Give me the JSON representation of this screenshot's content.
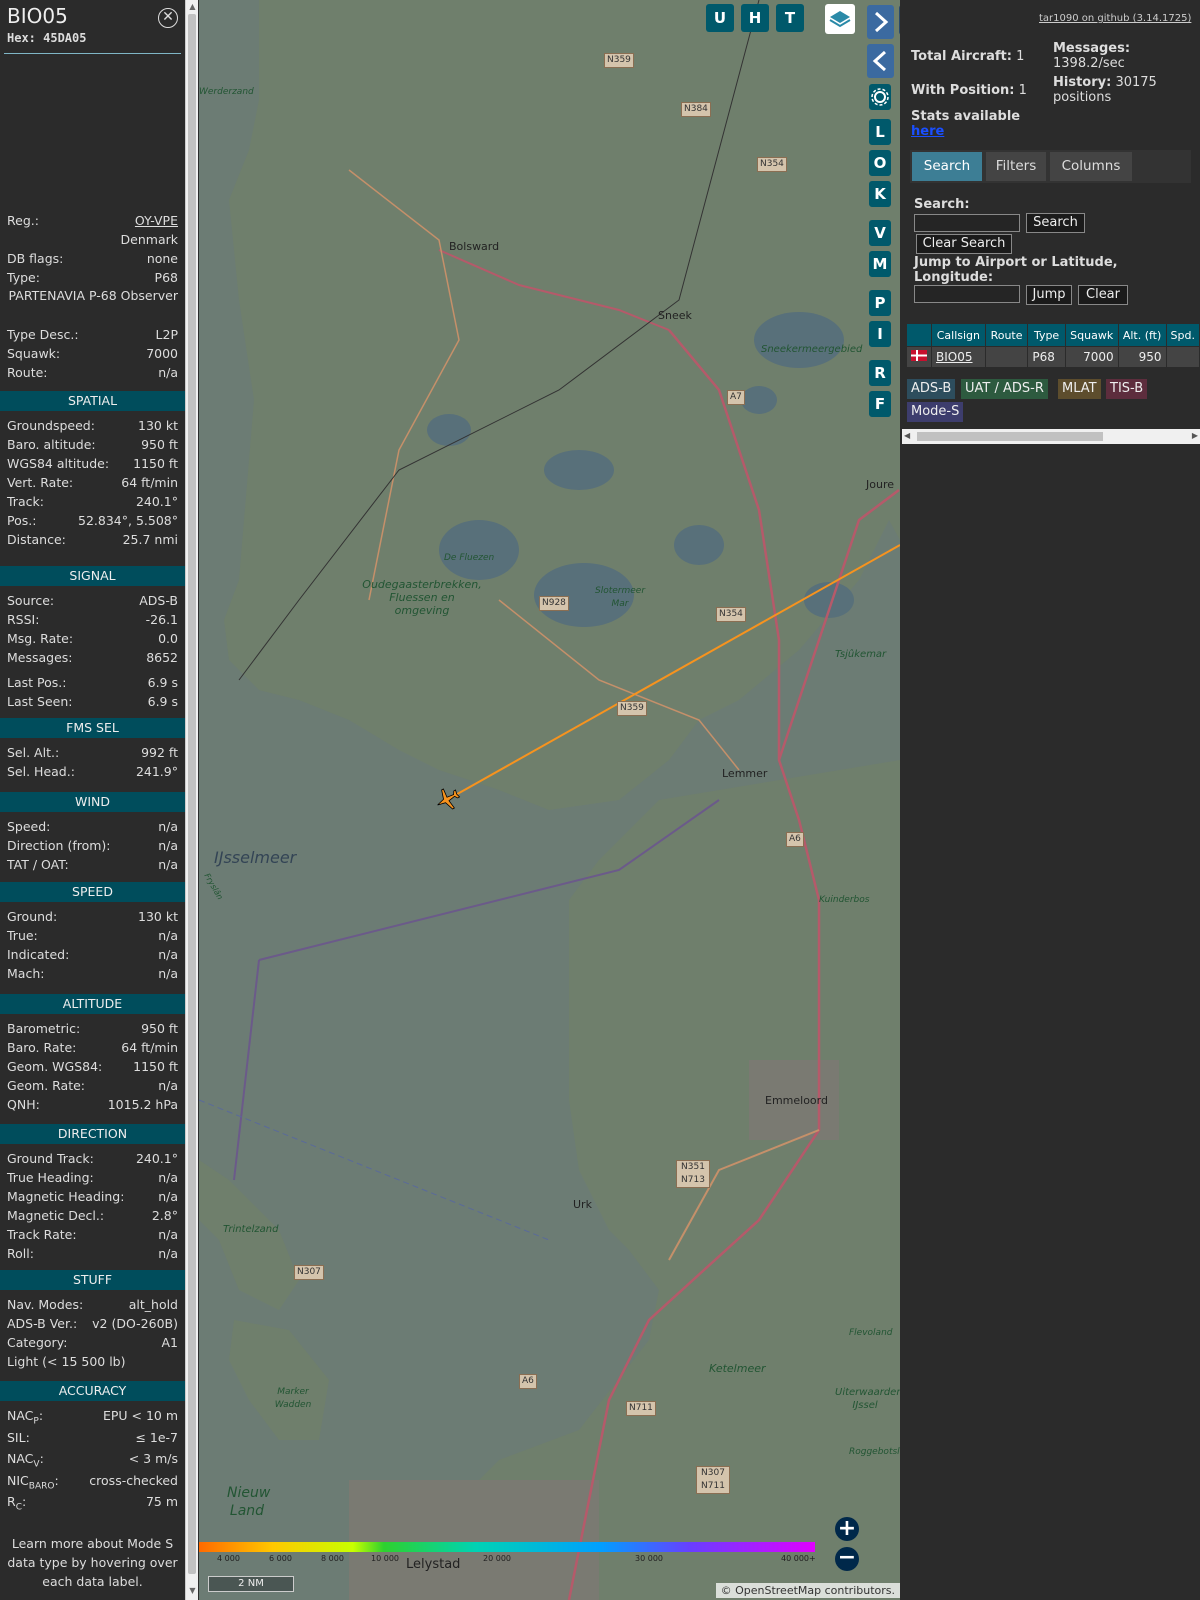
{
  "aircraft": {
    "callsign": "BIO05",
    "hex": "Hex: 45DA05",
    "rows_top": [
      {
        "k": "Reg.:",
        "v": "OY-VPE"
      },
      {
        "k": "",
        "v": "Denmark"
      },
      {
        "k": "DB flags:",
        "v": "none"
      },
      {
        "k": "Type:",
        "v": "P68"
      },
      {
        "k": "",
        "v": "PARTENAVIA P-68 Observer"
      },
      {
        "k": "Type Desc.:",
        "v": "L2P"
      },
      {
        "k": "Squawk:",
        "v": "7000"
      },
      {
        "k": "Route:",
        "v": "n/a"
      }
    ],
    "sections": [
      {
        "title": "SPATIAL",
        "rows": [
          {
            "k": "Groundspeed:",
            "v": "130 kt"
          },
          {
            "k": "Baro. altitude:",
            "v": "950 ft"
          },
          {
            "k": "WGS84 altitude:",
            "v": "1150 ft"
          },
          {
            "k": "Vert. Rate:",
            "v": "64 ft/min"
          },
          {
            "k": "Track:",
            "v": "240.1°"
          },
          {
            "k": "Pos.:",
            "v": "52.834°, 5.508°"
          },
          {
            "k": "Distance:",
            "v": "25.7 nmi"
          }
        ]
      },
      {
        "title": "SIGNAL",
        "rows": [
          {
            "k": "Source:",
            "v": "ADS-B"
          },
          {
            "k": "RSSI:",
            "v": "-26.1"
          },
          {
            "k": "Msg. Rate:",
            "v": "0.0"
          },
          {
            "k": "Messages:",
            "v": "8652"
          },
          {
            "k": "Last Pos.:",
            "v": "6.9 s"
          },
          {
            "k": "Last Seen:",
            "v": "6.9 s"
          }
        ]
      },
      {
        "title": "FMS SEL",
        "rows": [
          {
            "k": "Sel. Alt.:",
            "v": "992 ft"
          },
          {
            "k": "Sel. Head.:",
            "v": "241.9°"
          }
        ]
      },
      {
        "title": "WIND",
        "rows": [
          {
            "k": "Speed:",
            "v": "n/a"
          },
          {
            "k": "Direction (from):",
            "v": "n/a"
          },
          {
            "k": "TAT / OAT:",
            "v": "n/a"
          }
        ]
      },
      {
        "title": "SPEED",
        "rows": [
          {
            "k": "Ground:",
            "v": "130 kt"
          },
          {
            "k": "True:",
            "v": "n/a"
          },
          {
            "k": "Indicated:",
            "v": "n/a"
          },
          {
            "k": "Mach:",
            "v": "n/a"
          }
        ]
      },
      {
        "title": "ALTITUDE",
        "rows": [
          {
            "k": "Barometric:",
            "v": "950 ft"
          },
          {
            "k": "Baro. Rate:",
            "v": "64 ft/min"
          },
          {
            "k": "Geom. WGS84:",
            "v": "1150 ft"
          },
          {
            "k": "Geom. Rate:",
            "v": "n/a"
          },
          {
            "k": "QNH:",
            "v": "1015.2 hPa"
          }
        ]
      },
      {
        "title": "DIRECTION",
        "rows": [
          {
            "k": "Ground Track:",
            "v": "240.1°"
          },
          {
            "k": "True Heading:",
            "v": "n/a"
          },
          {
            "k": "Magnetic Heading:",
            "v": "n/a"
          },
          {
            "k": "Magnetic Decl.:",
            "v": "2.8°"
          },
          {
            "k": "Track Rate:",
            "v": "n/a"
          },
          {
            "k": "Roll:",
            "v": "n/a"
          }
        ]
      },
      {
        "title": "STUFF",
        "rows": [
          {
            "k": "Nav. Modes:",
            "v": "alt_hold"
          },
          {
            "k": "ADS-B Ver.:",
            "v": "v2 (DO-260B)"
          },
          {
            "k": "Category:",
            "v": "A1"
          },
          {
            "k": "Light (< 15 500 lb)",
            "v": ""
          }
        ]
      },
      {
        "title": "ACCURACY",
        "rows": [
          {
            "k": "NACP:",
            "v": "EPU < 10 m"
          },
          {
            "k": "SIL:",
            "v": "≤ 1e-7"
          },
          {
            "k": "NACV:",
            "v": "< 3 m/s"
          },
          {
            "k": "NICBARO:",
            "v": "cross-checked"
          },
          {
            "k": "RC:",
            "v": "75 m"
          }
        ]
      }
    ],
    "footer": "Learn more about Mode S data type by hovering over each data label."
  },
  "map": {
    "buttons_top": [
      "U",
      "H",
      "T"
    ],
    "buttons_side": [
      "L",
      "O",
      "K",
      "V",
      "M",
      "P",
      "I",
      "R",
      "F"
    ],
    "towns": [
      "Bolsward",
      "Sneek",
      "Joure",
      "Lemmer",
      "Emmeloord",
      "Urk",
      "Lelystad"
    ],
    "water": [
      "IJsselmeer",
      "Ketelmeer",
      "Sneekermeergebied",
      "Tsjûkemar"
    ],
    "parks": [
      "Oudegaasterbrekken, Fluessen en omgeving",
      "De Fluezen",
      "Slotermeer Mar",
      "Trintelzand",
      "Marker Wadden",
      "Nieuw Land",
      "Kuinderbos",
      "Uiterwaarden IJssel",
      "Roggebotsluis",
      "Werderzand",
      "Fryslân",
      "Flevoland"
    ],
    "roads": [
      "N359",
      "N384",
      "N354",
      "A7",
      "N928",
      "N354",
      "N359",
      "A6",
      "N351 N713",
      "N307",
      "A6",
      "N711",
      "N307 N711"
    ],
    "scale_ticks": [
      "4 000",
      "6 000",
      "8 000",
      "10 000",
      "20 000",
      "30 000",
      "40 000+"
    ],
    "scale_label": "2 NM",
    "attribution": "© OpenStreetMap contributors."
  },
  "right": {
    "github": "tar1090 on github (3.14.1725)",
    "total_label": "Total Aircraft:",
    "total": "1",
    "withpos_label": "With Position:",
    "withpos": "1",
    "messages_label": "Messages:",
    "messages": "1398.2/sec",
    "history_label": "History:",
    "history": "30175 positions",
    "stats_text": "Stats available",
    "stats_link": "here",
    "tabs": [
      "Search",
      "Filters",
      "Columns"
    ],
    "search_label": "Search:",
    "search_btn": "Search",
    "clear_search_btn": "Clear Search",
    "jump_label": "Jump to Airport or Latitude, Longitude:",
    "jump_btn": "Jump",
    "clear_btn": "Clear",
    "table": {
      "headers": [
        "",
        "Callsign",
        "Route",
        "Type",
        "Squawk",
        "Alt. (ft)",
        "Spd."
      ],
      "row": {
        "callsign": "BIO05",
        "route": "",
        "type": "P68",
        "squawk": "7000",
        "alt": "950",
        "spd": ""
      }
    },
    "badges": [
      "ADS-B",
      "UAT / ADS-R",
      "MLAT",
      "TIS-B",
      "Mode-S"
    ]
  },
  "colors": {
    "accent": "#00596b",
    "track": "#f7931e",
    "adsb": "#2d4d5d",
    "uat": "#2d5a3f",
    "mlat": "#5d4d2d",
    "tisb": "#5d2d3d",
    "modes": "#3d3d6d"
  }
}
